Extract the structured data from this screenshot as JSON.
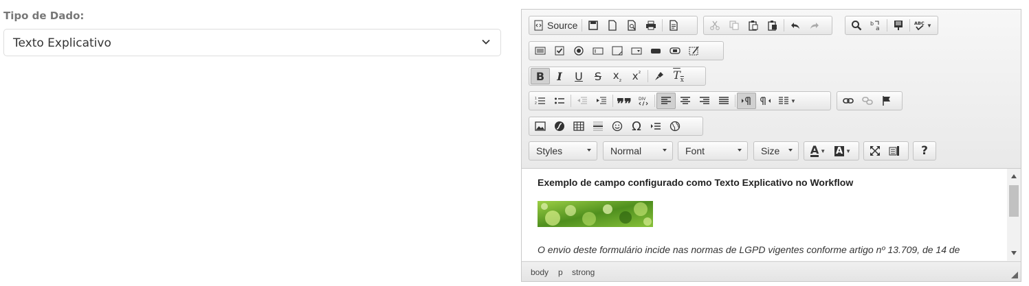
{
  "form": {
    "label": "Tipo de Dado:",
    "select_value": "Texto Explicativo"
  },
  "toolbar": {
    "source_label": "Source",
    "combos": {
      "styles": "Styles",
      "format": "Normal",
      "font": "Font",
      "size": "Size"
    }
  },
  "content": {
    "title": "Exemplo de campo configurado como Texto Explicativo no Workflow",
    "paragraph": "O envio deste formulário incide nas normas de LGPD vigentes conforme artigo nº 13.709, de 14 de"
  },
  "statusbar": {
    "path": [
      "body",
      "p",
      "strong"
    ]
  },
  "colors": {
    "image_green": "#6fae2a",
    "toolbar_bg": "#ececec"
  }
}
